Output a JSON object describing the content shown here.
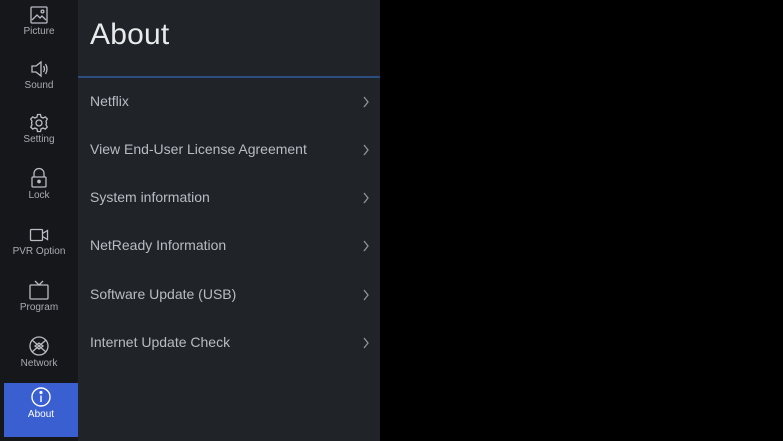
{
  "sidebar": {
    "items": [
      {
        "label": "Picture",
        "icon": "picture-icon"
      },
      {
        "label": "Sound",
        "icon": "speaker-icon"
      },
      {
        "label": "Setting",
        "icon": "gear-icon"
      },
      {
        "label": "Lock",
        "icon": "lock-icon"
      },
      {
        "label": "PVR Option",
        "icon": "camera-icon"
      },
      {
        "label": "Program",
        "icon": "tv-icon"
      },
      {
        "label": "Network",
        "icon": "globe-icon"
      },
      {
        "label": "About",
        "icon": "info-icon"
      }
    ],
    "active_item": "About"
  },
  "panel": {
    "title": "About",
    "items": [
      {
        "label": "Netflix"
      },
      {
        "label": "View End-User License Agreement"
      },
      {
        "label": "System information"
      },
      {
        "label": "NetReady Information"
      },
      {
        "label": "Software Update (USB)"
      },
      {
        "label": "Internet Update Check"
      }
    ]
  },
  "colors": {
    "accent": "#3a5fd0",
    "divider": "#2b4e7e",
    "panel_bg": "#202429",
    "sidebar_bg": "#15171b"
  }
}
